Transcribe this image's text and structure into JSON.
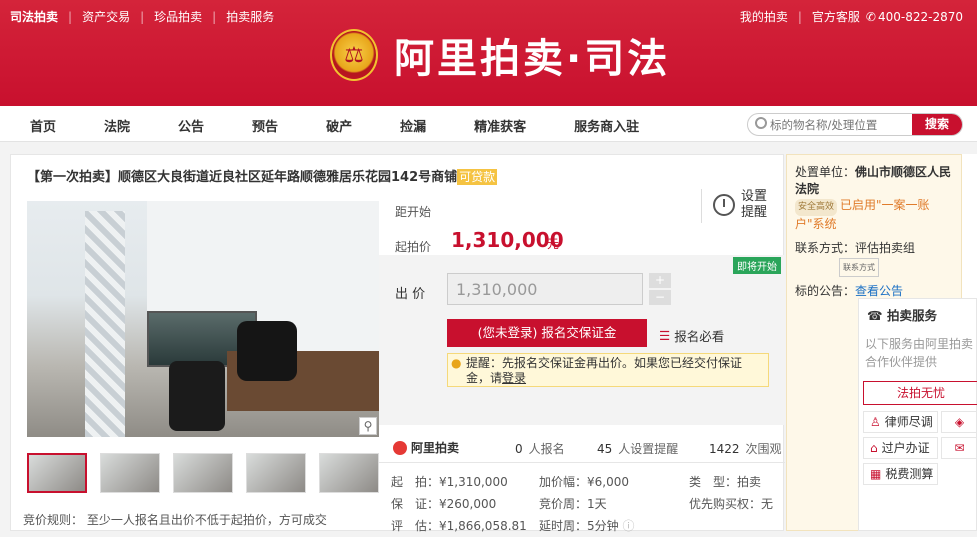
{
  "topnav": {
    "items": [
      "司法拍卖",
      "资产交易",
      "珍品拍卖",
      "拍卖服务"
    ],
    "my_auction": "我的拍卖",
    "service_label": "官方客服",
    "phone": "400-822-2870"
  },
  "brand": {
    "title": "阿里拍卖·司法"
  },
  "mainnav": {
    "links": [
      "首页",
      "法院",
      "公告",
      "预告",
      "破产",
      "捡漏",
      "精准获客",
      "服务商入驻"
    ],
    "search_placeholder": "标的物名称/处理位置",
    "search_button": "搜索"
  },
  "item": {
    "title_prefix": "【第一次拍卖】顺德区大良街道近良社区延年路顺德雅居乐花园142号商铺",
    "title_tag": "可贷款",
    "countdown_label": "距开始",
    "remind_label": "设置提醒",
    "start_label": "起拍价",
    "start_price": "1,310,000",
    "start_unit": "元",
    "soon_badge": "即将开始",
    "bid_label": "出 价",
    "bid_value": "1,310,000",
    "stepper_plus": "+",
    "stepper_minus": "−",
    "register_button": "(您未登录) 报名交保证金",
    "must_read": "报名必看",
    "tip_text": "提醒：先报名交保证金再出价。如果您已经交付保证金，请",
    "tip_link": "登录"
  },
  "stats": {
    "platform": "阿里拍卖",
    "registrations": "0",
    "registrations_label": "人报名",
    "reminders": "45",
    "reminders_label": "人设置提醒",
    "views": "1422",
    "views_label": "次围观"
  },
  "details": {
    "start_row": "起　拍：¥1,310,000",
    "deposit_row": "保　证：¥260,000",
    "appraisal_row": "评　估：¥1,866,058.81",
    "increment_row": "加价幅：¥6,000",
    "cycle_row": "竞价周：1天",
    "delay_row": "延时周：5分钟",
    "type_row": "类　型：拍卖",
    "priority_row": "优先购买权：无",
    "rule": "竞价规则：  至少一人报名且出价不低于起拍价，方可成交"
  },
  "side": {
    "unit_label": "处置单位：",
    "unit_name": "佛山市顺德区人民法院",
    "safe_badge": "安全高效",
    "enabled_text": "已启用\"一案一账户\"系统",
    "contact_label": "联系方式：",
    "contact_value": "评估拍卖组",
    "contact_badge": "联系方式",
    "notice_label": "标的公告：",
    "notice_link": "查看公告"
  },
  "service": {
    "title": "拍卖服务",
    "desc": "以下服务由阿里拍卖合作伙伴提供",
    "btn": "法拍无忧",
    "rows": [
      "律师尽调",
      "过户办证",
      "税费测算"
    ]
  },
  "colors": {
    "brand_red": "#c8102e",
    "link_blue": "#1a6fc4",
    "tag_yellow": "#f5c342",
    "soon_green": "#2aa55a"
  }
}
